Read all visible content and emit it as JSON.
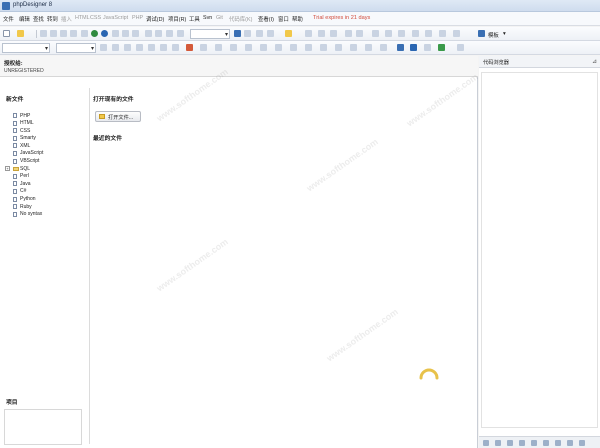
{
  "window": {
    "title": "phpDesigner 8"
  },
  "menu": {
    "items": [
      {
        "label": "文件",
        "enabled": true
      },
      {
        "label": "编辑",
        "enabled": true
      },
      {
        "label": "查找",
        "enabled": true
      },
      {
        "label": "转到",
        "enabled": true
      },
      {
        "label": "插入",
        "enabled": false
      },
      {
        "label": "HTML",
        "enabled": false
      },
      {
        "label": "CSS",
        "enabled": false
      },
      {
        "label": "JavaScript",
        "enabled": false
      },
      {
        "label": "PHP",
        "enabled": false
      },
      {
        "label": "调试(D)",
        "enabled": true
      },
      {
        "label": "项目(R)",
        "enabled": true
      },
      {
        "label": "工具",
        "enabled": true
      },
      {
        "label": "Svn",
        "enabled": true
      },
      {
        "label": "Git",
        "enabled": false
      },
      {
        "label": "代码库(K)",
        "enabled": false
      },
      {
        "label": "查看(I)",
        "enabled": true
      },
      {
        "label": "窗口",
        "enabled": true
      },
      {
        "label": "帮助",
        "enabled": true
      }
    ],
    "trial_notice": "Trial expires in 21 days"
  },
  "toolbar": {
    "template_label": "模板"
  },
  "registration": {
    "label": "授权给:",
    "status": "UNREGISTERED"
  },
  "new_file": {
    "title": "新文件",
    "items": [
      {
        "label": "PHP",
        "folder": false
      },
      {
        "label": "HTML",
        "folder": false
      },
      {
        "label": "CSS",
        "folder": false
      },
      {
        "label": "Smarty",
        "folder": false
      },
      {
        "label": "XML",
        "folder": false
      },
      {
        "label": "JavaScript",
        "folder": false
      },
      {
        "label": "VBScript",
        "folder": false
      },
      {
        "label": "SQL",
        "folder": true
      },
      {
        "label": "Perl",
        "folder": false
      },
      {
        "label": "Java",
        "folder": false
      },
      {
        "label": "C#",
        "folder": false
      },
      {
        "label": "Python",
        "folder": false
      },
      {
        "label": "Ruby",
        "folder": false
      },
      {
        "label": "No syntax",
        "folder": false
      }
    ]
  },
  "projects": {
    "title": "项目"
  },
  "open_files": {
    "title": "打开现有的文件",
    "button_label": "打开文件..."
  },
  "recent_files": {
    "title": "最近的文件"
  },
  "code_browser": {
    "title": "代码浏览器",
    "pin_icon": "pin-icon"
  },
  "watermark": {
    "text": "www.softhome.com"
  },
  "colors": {
    "trial": "#d24a3a",
    "accent": "#3a6fb3",
    "spinner": "#e8c24a"
  }
}
